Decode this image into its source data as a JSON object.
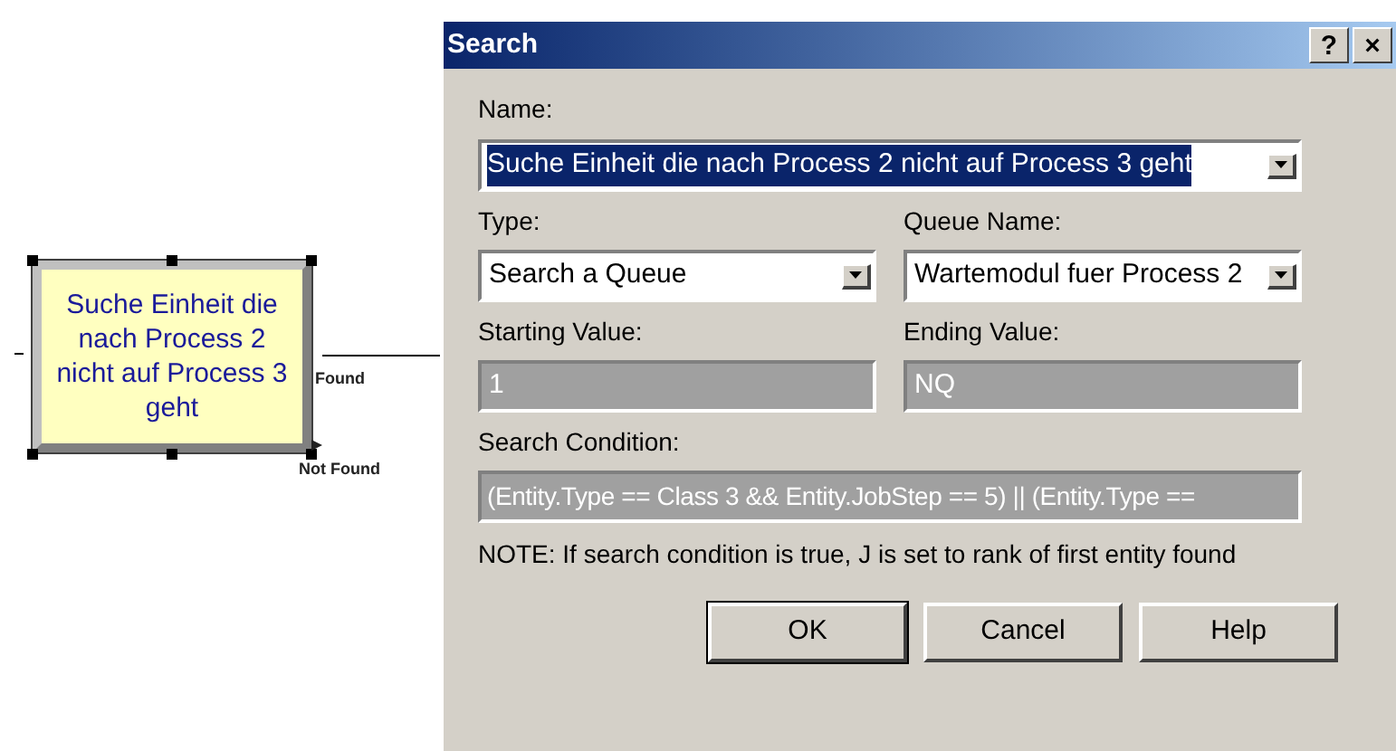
{
  "canvas": {
    "module": {
      "label": "Suche Einheit die nach Process 2 nicht auf Process 3 geht",
      "selected": true
    },
    "exits": [
      {
        "label": "Found",
        "kind": "connected"
      },
      {
        "label": "Not Found",
        "kind": "open"
      }
    ]
  },
  "dialog": {
    "title": "Search",
    "title_buttons": [
      "?",
      "×"
    ],
    "name": {
      "label": "Name:",
      "value": "Suche Einheit die nach Process 2 nicht auf Process 3 geht",
      "highlighted": true
    },
    "rows": [
      [
        {
          "label": "Type:",
          "value": "Search a Queue",
          "kind": "combo",
          "disabled": false
        },
        {
          "label": "Queue Name:",
          "value": "Wartemodul fuer Process 2",
          "kind": "combo",
          "disabled": false
        }
      ],
      [
        {
          "label": "Starting Value:",
          "value": "1",
          "kind": "text",
          "disabled": true
        },
        {
          "label": "Ending Value:",
          "value": "NQ",
          "kind": "text",
          "disabled": true
        }
      ]
    ],
    "condition": {
      "label": "Search Condition:",
      "value": "(Entity.Type == Class 3 && Entity.JobStep == 5) || (Entity.Type ==",
      "disabled": true
    },
    "note": "NOTE: If search condition is true, J is set to rank of first entity found",
    "buttons": [
      {
        "label": "OK",
        "default": true
      },
      {
        "label": "Cancel",
        "default": false
      },
      {
        "label": "Help",
        "default": false
      }
    ]
  }
}
